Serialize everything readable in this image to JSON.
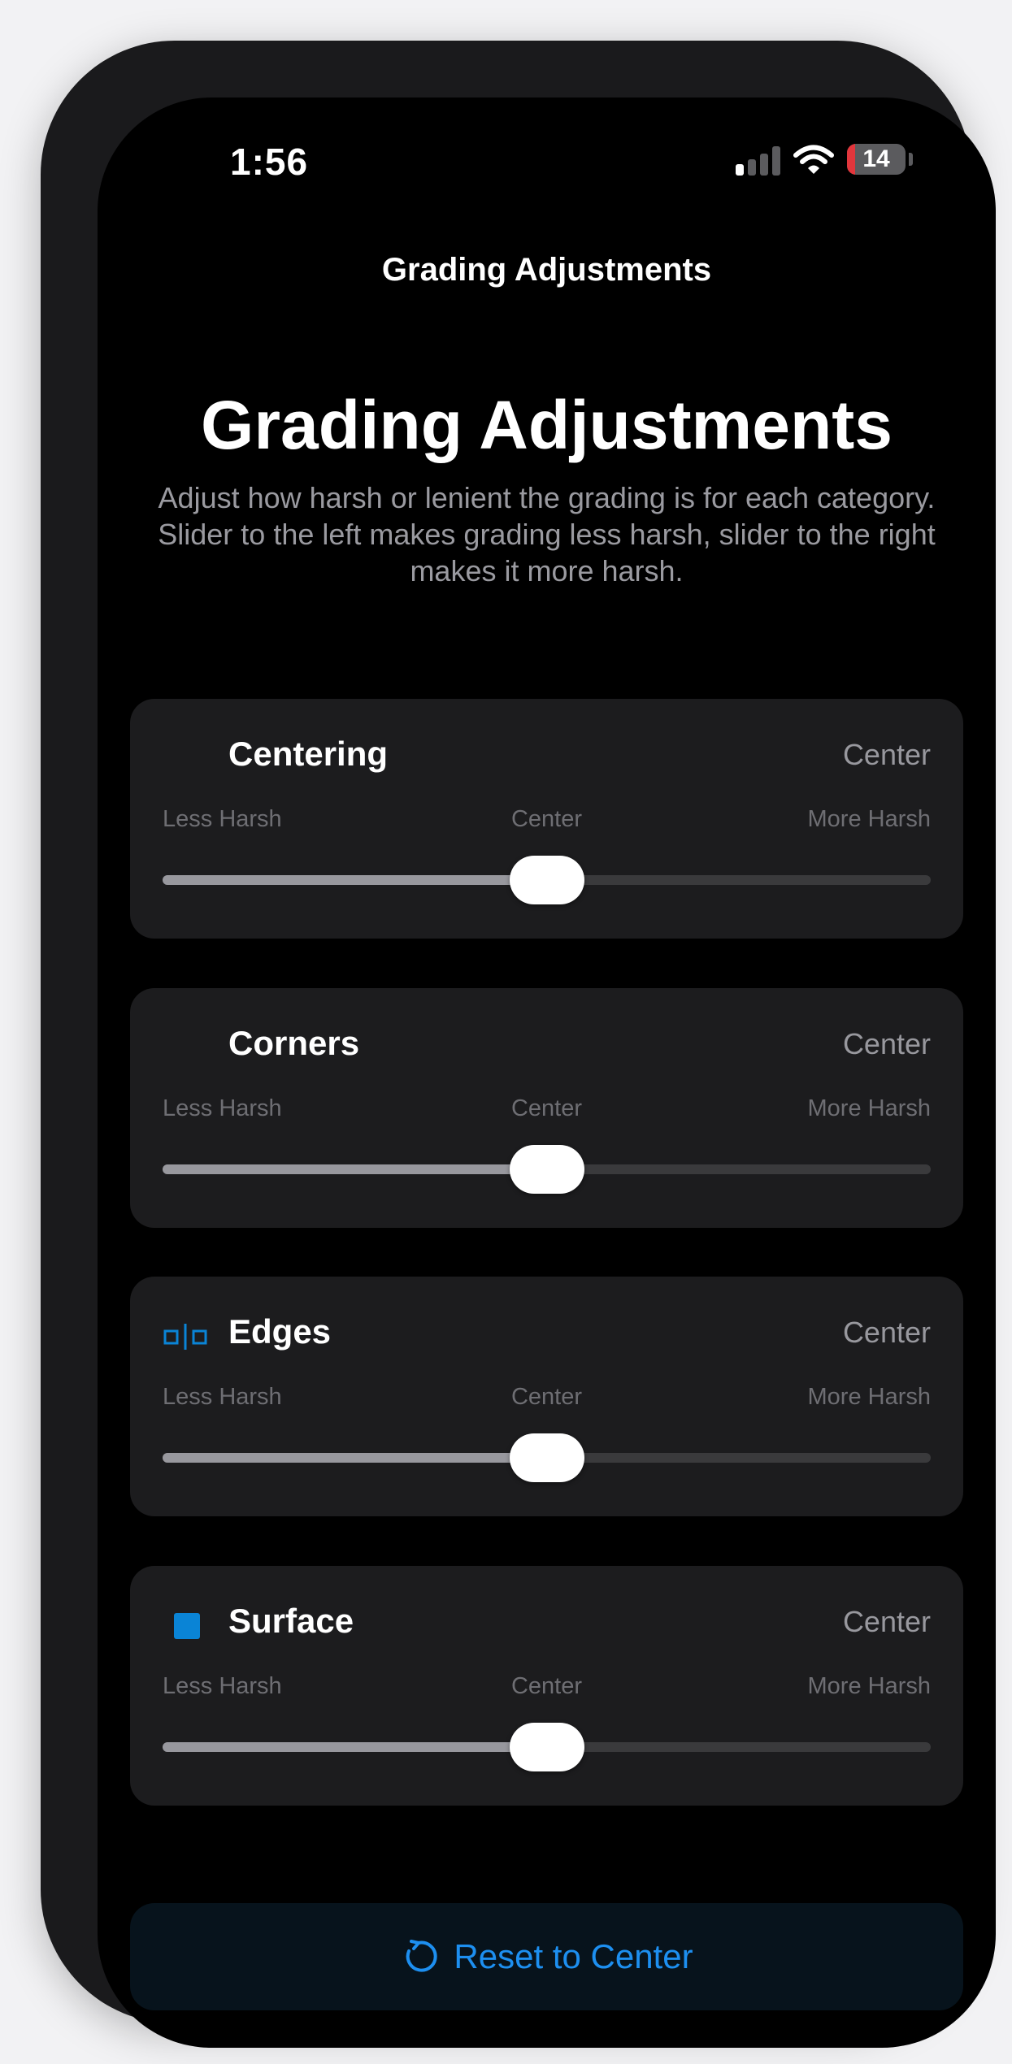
{
  "status_bar": {
    "time": "1:56",
    "battery_level": "14",
    "battery_color": "#e2363c"
  },
  "nav": {
    "title": "Grading Adjustments"
  },
  "header": {
    "title": "Grading Adjustments",
    "description": "Adjust how harsh or lenient the grading is for each category. Slider to the left makes grading less harsh, slider to the right makes it more harsh."
  },
  "categories": [
    {
      "title": "Centering",
      "value": "Center",
      "icon": "none",
      "scale": {
        "left": "Less Harsh",
        "mid": "Center",
        "right": "More Harsh"
      },
      "slider_fraction": 0.5
    },
    {
      "title": "Corners",
      "value": "Center",
      "icon": "none",
      "scale": {
        "left": "Less Harsh",
        "mid": "Center",
        "right": "More Harsh"
      },
      "slider_fraction": 0.5
    },
    {
      "title": "Edges",
      "value": "Center",
      "icon": "edges-icon",
      "scale": {
        "left": "Less Harsh",
        "mid": "Center",
        "right": "More Harsh"
      },
      "slider_fraction": 0.5
    },
    {
      "title": "Surface",
      "value": "Center",
      "icon": "surface-square-icon",
      "scale": {
        "left": "Less Harsh",
        "mid": "Center",
        "right": "More Harsh"
      },
      "slider_fraction": 0.5
    }
  ],
  "reset": {
    "label": "Reset to Center",
    "icon": "reset-arrow-icon",
    "color": "#1d8ff0"
  },
  "colors": {
    "accent": "#1d8ff0",
    "icon_blue": "#0a84d6",
    "card_bg": "#1c1c1e",
    "background": "#000000"
  }
}
